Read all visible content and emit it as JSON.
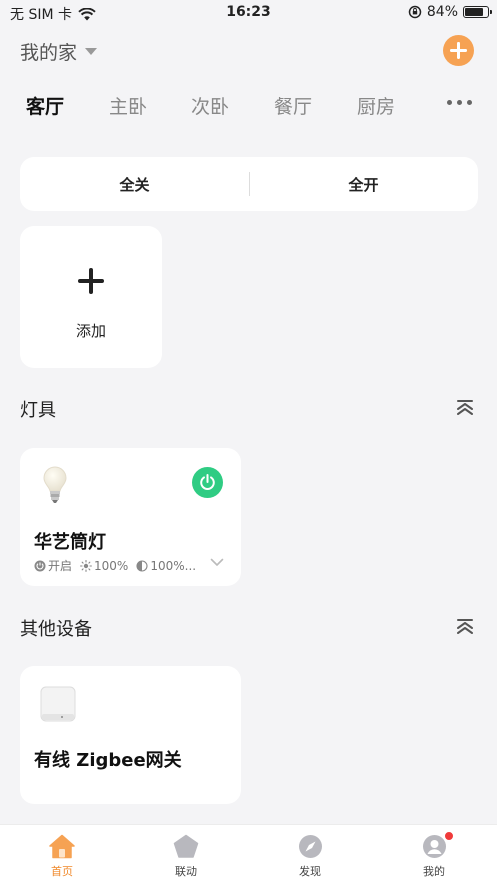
{
  "status_bar": {
    "carrier": "无 SIM 卡",
    "time": "16:23",
    "battery": "84%",
    "battery_level": 0.84
  },
  "header": {
    "home_name": "我的家"
  },
  "rooms": [
    "客厅",
    "主卧",
    "次卧",
    "餐厅",
    "厨房"
  ],
  "active_room": "客厅",
  "switch_bar": {
    "all_off": "全关",
    "all_on": "全开"
  },
  "add_card": {
    "label": "添加"
  },
  "sections": {
    "lights": {
      "title": "灯具"
    },
    "others": {
      "title": "其他设备"
    }
  },
  "devices": {
    "light": {
      "name": "华艺筒灯",
      "state": "开启",
      "brightness": "100%",
      "color_temp": "100%..."
    },
    "gateway": {
      "name": "有线 Zigbee网关"
    }
  },
  "tabs": [
    {
      "label": "首页",
      "icon": "home-icon"
    },
    {
      "label": "联动",
      "icon": "pentagon-icon"
    },
    {
      "label": "发现",
      "icon": "compass-icon"
    },
    {
      "label": "我的",
      "icon": "profile-icon"
    }
  ],
  "colors": {
    "accent": "#f6a253",
    "power_on": "#2fcc83",
    "badge": "#f03a3a"
  }
}
